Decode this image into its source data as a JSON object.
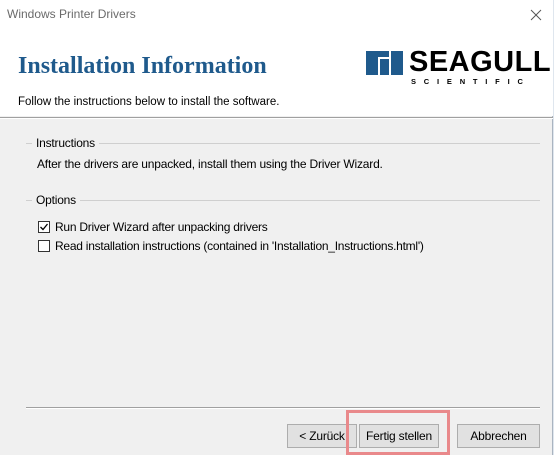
{
  "window": {
    "title": "Windows Printer Drivers",
    "close_glyph": "✕"
  },
  "header": {
    "title": "Installation Information",
    "subtitle": "Follow the instructions below to install the software.",
    "logo": {
      "word": "SEAGULL",
      "sub": "SCIENTIFIC",
      "icon": "seagull-logo-icon"
    }
  },
  "instructions": {
    "label": "Instructions",
    "text": "After the drivers are unpacked, install them using the Driver Wizard."
  },
  "options": {
    "label": "Options",
    "items": [
      {
        "label": "Run Driver Wizard after unpacking drivers",
        "checked": true
      },
      {
        "label": "Read installation instructions (contained in 'Installation_Instructions.html')",
        "checked": false
      }
    ]
  },
  "buttons": {
    "back": "< Zurück",
    "finish": "Fertig stellen",
    "cancel": "Abbrechen"
  },
  "colors": {
    "title_blue": "#1f5a8c",
    "highlight": "#e9898b"
  }
}
